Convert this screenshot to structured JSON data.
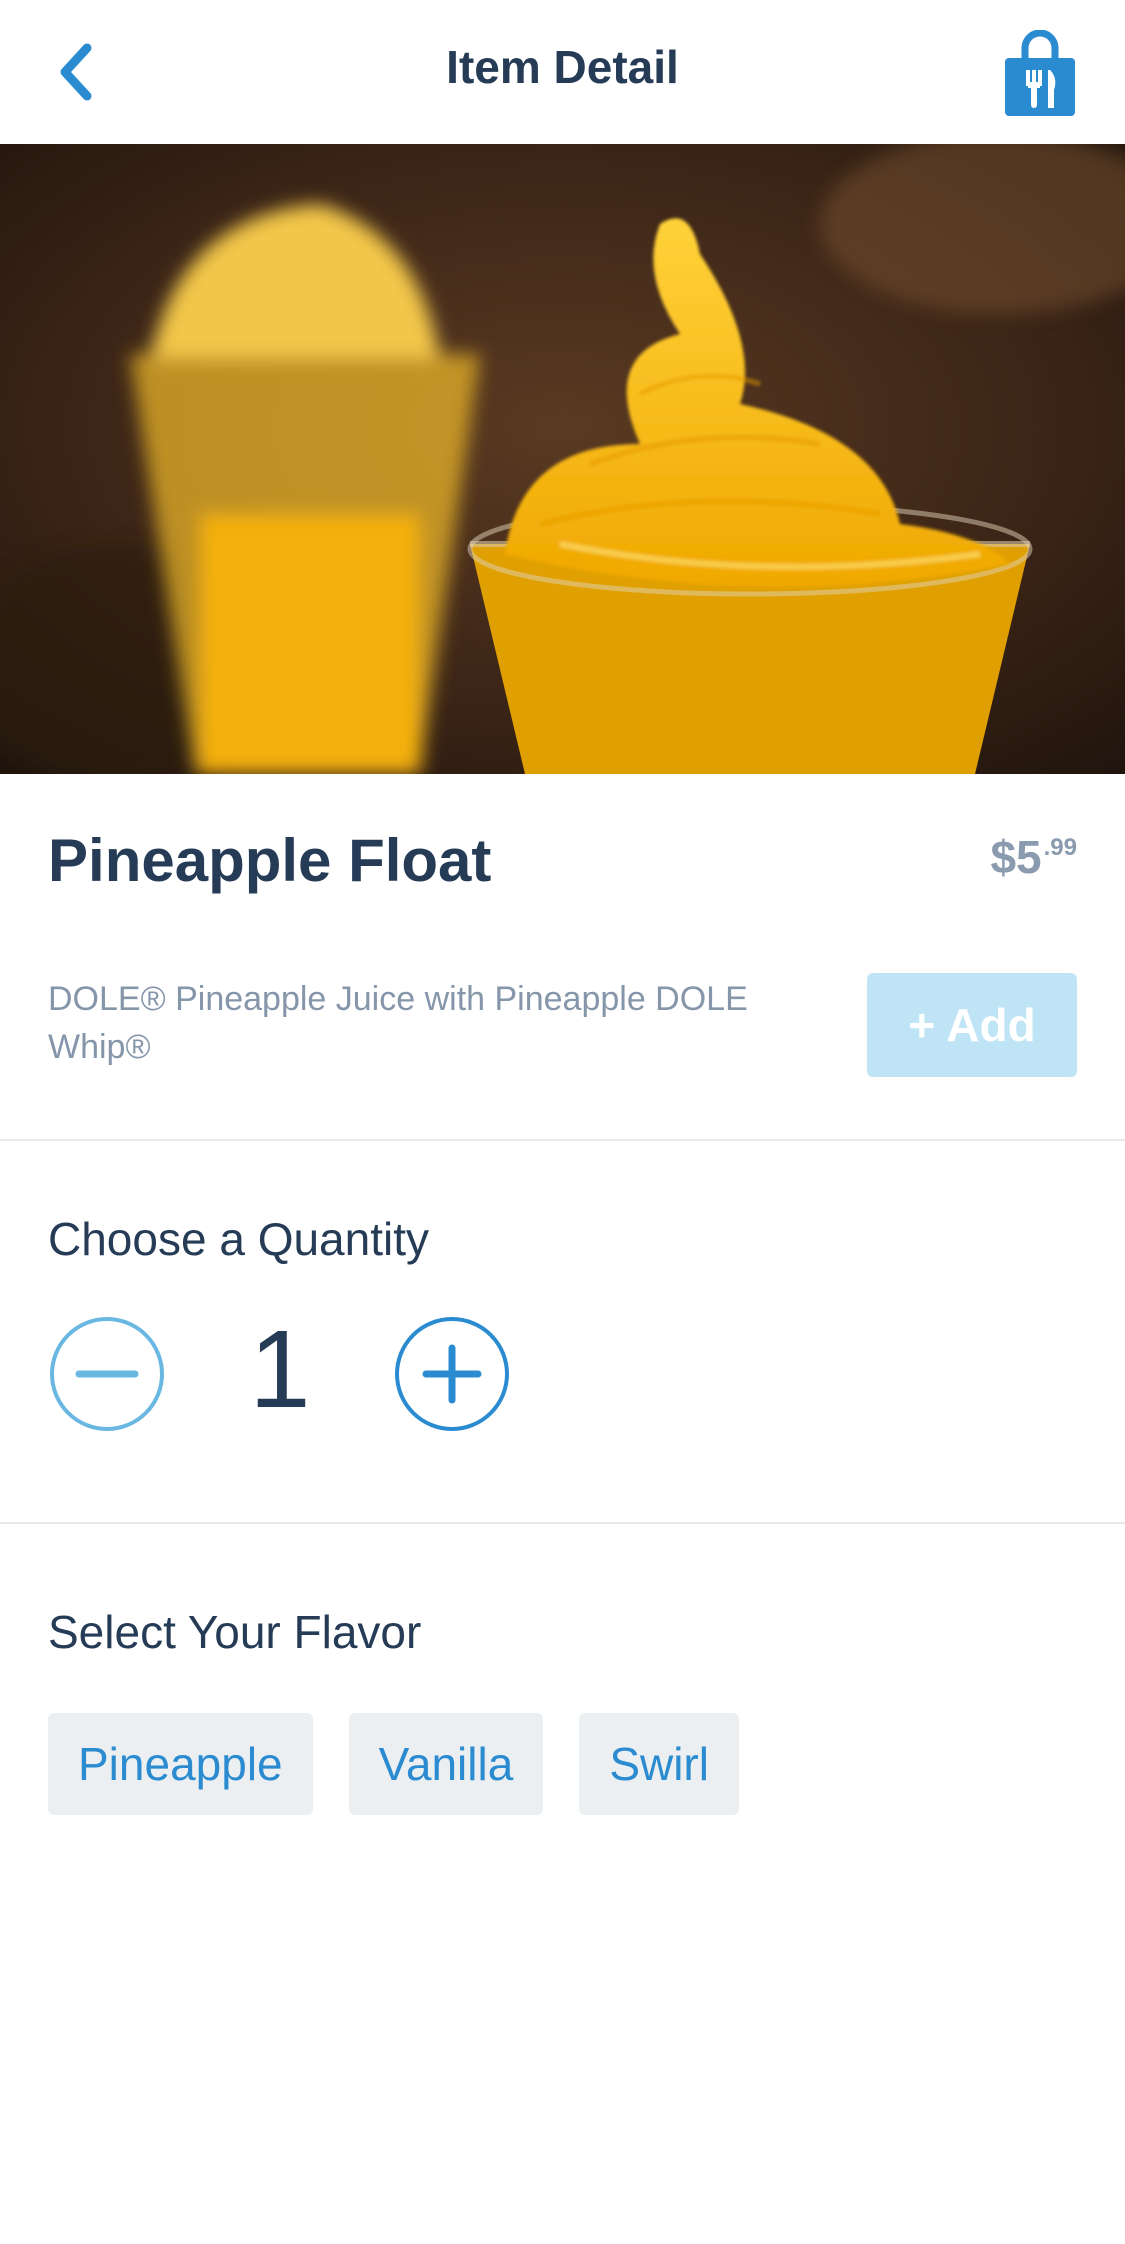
{
  "header": {
    "title": "Item Detail",
    "back_icon": "chevron-left-icon",
    "cart_icon": "shopping-bag-utensils-icon"
  },
  "item": {
    "name": "Pineapple Float",
    "price_dollars": "$5",
    "price_cents": ".99",
    "description": "DOLE® Pineapple Juice with Pineapple DOLE Whip®",
    "add_label": "+ Add"
  },
  "quantity": {
    "title": "Choose a Quantity",
    "value": "1",
    "decrement_icon": "minus-circle-icon",
    "increment_icon": "plus-circle-icon"
  },
  "flavor": {
    "title": "Select Your Flavor",
    "options": [
      "Pineapple",
      "Vanilla",
      "Swirl"
    ]
  },
  "colors": {
    "accent": "#2b8bd0",
    "title_text": "#253b56",
    "muted_text": "#8696aa",
    "add_button_disabled": "#bfe4f6",
    "chip_background": "#ebeff1"
  }
}
